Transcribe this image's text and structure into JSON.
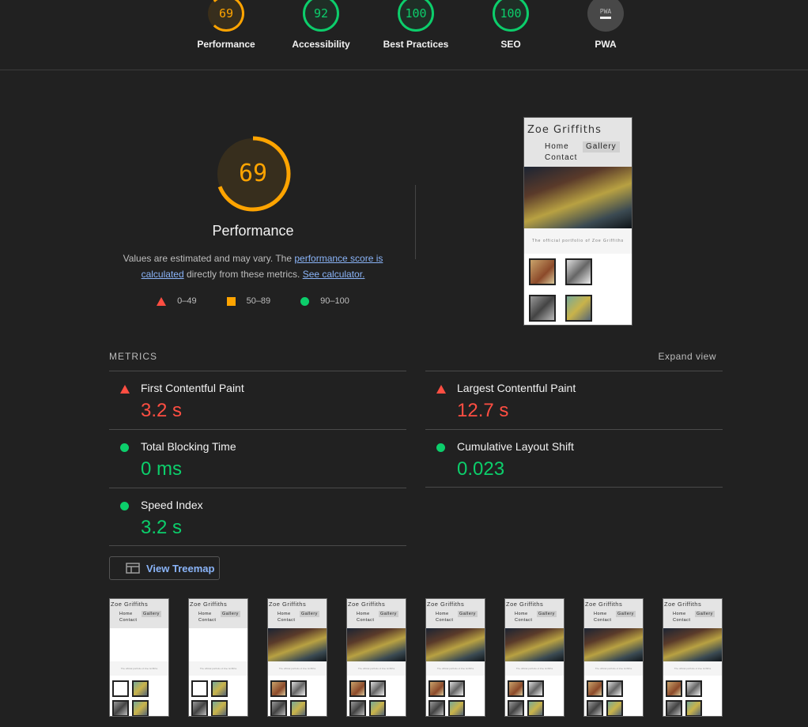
{
  "categories": [
    {
      "label": "Performance",
      "score": "69",
      "color": "#ffa400"
    },
    {
      "label": "Accessibility",
      "score": "92",
      "color": "#0cce6b"
    },
    {
      "label": "Best Practices",
      "score": "100",
      "color": "#0cce6b"
    },
    {
      "label": "SEO",
      "score": "100",
      "color": "#0cce6b"
    },
    {
      "label": "PWA",
      "score": "PWA",
      "color": "#484848"
    }
  ],
  "performance": {
    "score": "69",
    "score_fraction": 0.69,
    "title": "Performance",
    "desc_prefix": "Values are estimated and may vary. The ",
    "link1": "performance score is calculated",
    "desc_mid": " directly from these metrics. ",
    "link2": "See calculator.",
    "legend": {
      "red": "0–49",
      "orange": "50–89",
      "green": "90–100"
    }
  },
  "preview": {
    "site_name": "Zoe Griffiths",
    "nav_home": "Home",
    "nav_gallery": "Gallery",
    "nav_contact": "Contact",
    "tagline": "The official portfolio of Zoe Griffiths"
  },
  "metrics": {
    "heading": "METRICS",
    "expand": "Expand view",
    "items": [
      {
        "name": "First Contentful Paint",
        "value": "3.2 s",
        "status": "red"
      },
      {
        "name": "Largest Contentful Paint",
        "value": "12.7 s",
        "status": "red"
      },
      {
        "name": "Total Blocking Time",
        "value": "0 ms",
        "status": "green"
      },
      {
        "name": "Cumulative Layout Shift",
        "value": "0.023",
        "status": "green"
      },
      {
        "name": "Speed Index",
        "value": "3.2 s",
        "status": "green"
      }
    ]
  },
  "treemap_label": "View Treemap",
  "colors": {
    "red": "#ff4e42",
    "orange": "#ffa400",
    "green": "#0cce6b",
    "link": "#8ab4f8"
  }
}
